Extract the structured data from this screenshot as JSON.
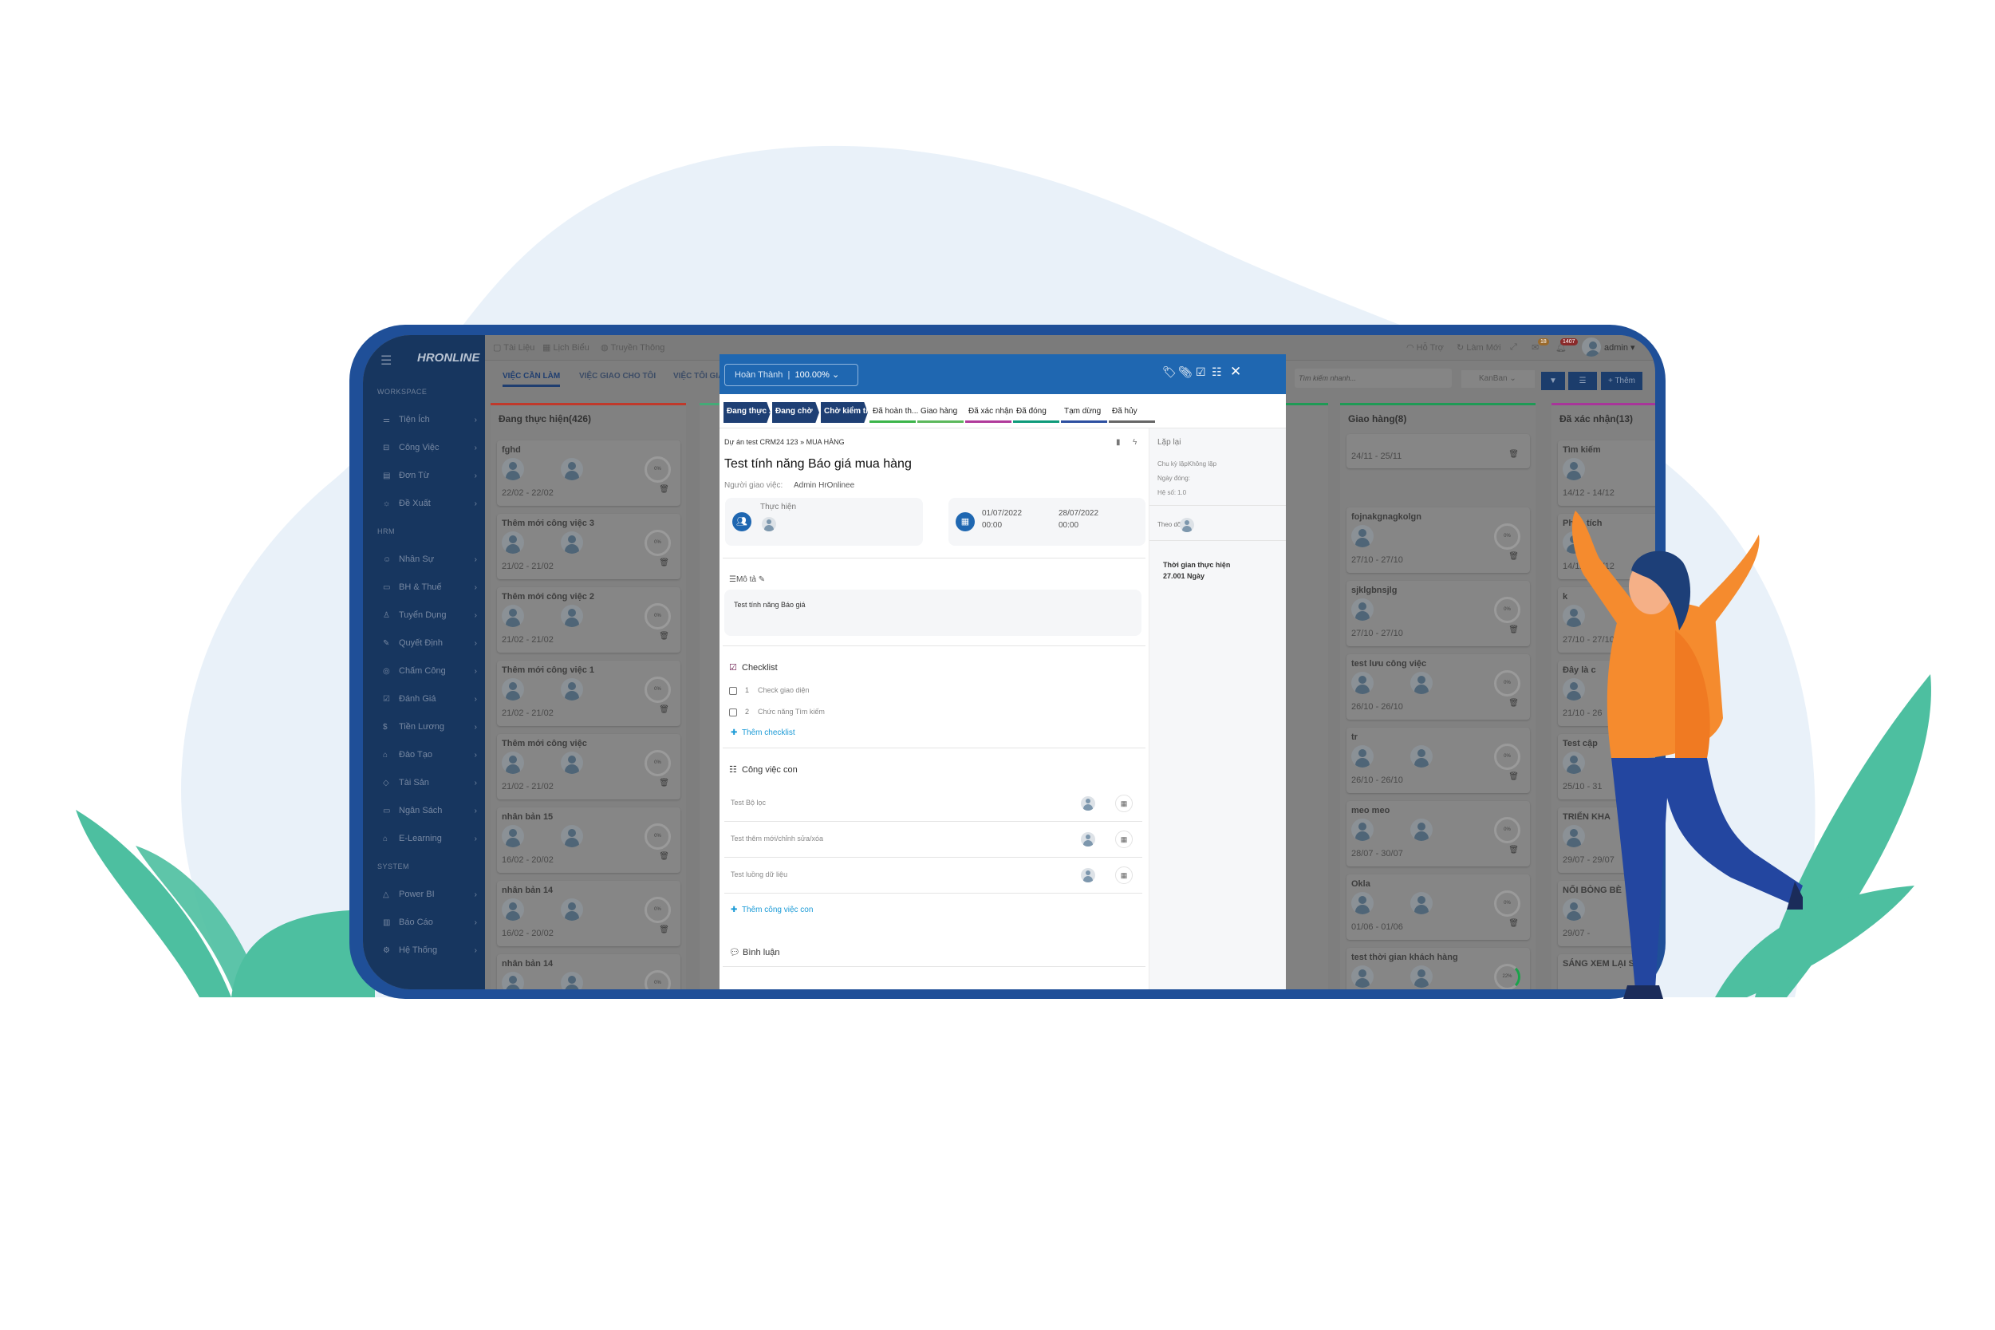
{
  "colors": {
    "brand": "#1f4f98",
    "modal_header": "#1f67b1",
    "leaf": "#4dbfa0",
    "blob": "#e9f1f9"
  },
  "app": {
    "logo": "HRONLINE",
    "topbar": {
      "links": [
        "Tài Liệu",
        "Lịch Biểu",
        "Truyền Thông"
      ],
      "support": "Hỗ Trợ",
      "refresh": "Làm Mới",
      "mail_badge": "18",
      "notif_badge": "1407",
      "user": "admin"
    },
    "tabs": [
      "VIỆC CẦN LÀM",
      "VIỆC GIAO CHO TÔI",
      "VIỆC TÔI GIA"
    ],
    "search_placeholder": "Tìm kiếm nhanh...",
    "view_select": "KanBan",
    "add_button": "+ Thêm",
    "sidebar": [
      {
        "section": "WORKSPACE"
      },
      {
        "label": "Tiện Ích",
        "icon": "sliders-icon"
      },
      {
        "label": "Công Việc",
        "icon": "briefcase-icon"
      },
      {
        "label": "Đơn Từ",
        "icon": "document-icon"
      },
      {
        "label": "Đề Xuất",
        "icon": "lightbulb-icon"
      },
      {
        "section": "HRM"
      },
      {
        "label": "Nhân Sự",
        "icon": "users-icon"
      },
      {
        "label": "BH & Thuế",
        "icon": "wallet-icon"
      },
      {
        "label": "Tuyển Dụng",
        "icon": "user-plus-icon"
      },
      {
        "label": "Quyết Định",
        "icon": "decision-icon"
      },
      {
        "label": "Chấm Công",
        "icon": "location-icon"
      },
      {
        "label": "Đánh Giá",
        "icon": "calendar-check-icon"
      },
      {
        "label": "Tiền Lương",
        "icon": "dollar-icon"
      },
      {
        "label": "Đào Tạo",
        "icon": "graduation-icon"
      },
      {
        "label": "Tài Sản",
        "icon": "diamond-icon"
      },
      {
        "label": "Ngân Sách",
        "icon": "wallet-icon"
      },
      {
        "label": "E-Learning",
        "icon": "graduation-icon"
      },
      {
        "section": "SYSTEM"
      },
      {
        "label": "Power BI",
        "icon": "chart-area-icon"
      },
      {
        "label": "Báo Cáo",
        "icon": "bar-chart-icon"
      },
      {
        "label": "Hệ Thống",
        "icon": "gear-icon"
      }
    ],
    "columns": [
      {
        "title": "Đang thực hiện(426)",
        "color": "#c0392b",
        "cards": [
          {
            "title": "fghd",
            "date": "22/02 - 22/02",
            "avatars": 2,
            "progress": "0%"
          },
          {
            "title": "Thêm mới công việc 3",
            "date": "21/02 - 21/02",
            "avatars": 2,
            "progress": "0%"
          },
          {
            "title": "Thêm mới công việc 2",
            "date": "21/02 - 21/02",
            "avatars": 2,
            "progress": "0%"
          },
          {
            "title": "Thêm mới công việc 1",
            "date": "21/02 - 21/02",
            "avatars": 2,
            "progress": "0%"
          },
          {
            "title": "Thêm mới công việc",
            "date": "21/02 - 21/02",
            "avatars": 2,
            "progress": "0%"
          },
          {
            "title": "nhân bản 15",
            "date": "16/02 - 20/02",
            "avatars": 2,
            "progress": "0%"
          },
          {
            "title": "nhân bản 14",
            "date": "16/02 - 20/02",
            "avatars": 2,
            "progress": "0%"
          },
          {
            "title": "nhân bản 14",
            "date": "",
            "avatars": 2,
            "progress": "0%"
          }
        ]
      },
      {
        "title": "Giao hàng(8)",
        "color": "#1e9a55",
        "cards": [
          {
            "title": "",
            "date": "24/11 - 25/11",
            "avatars": 0,
            "progress": ""
          },
          {
            "title": "fojnakgnagkolgn",
            "date": "27/10 - 27/10",
            "avatars": 1,
            "progress": "0%"
          },
          {
            "title": "sjklgbnsjlg",
            "date": "27/10 - 27/10",
            "avatars": 1,
            "progress": "0%"
          },
          {
            "title": "test lưu công việc",
            "date": "26/10 - 26/10",
            "avatars": 2,
            "progress": "0%"
          },
          {
            "title": "tr",
            "date": "26/10 - 26/10",
            "avatars": 2,
            "progress": "0%"
          },
          {
            "title": "meo meo",
            "date": "28/07 - 30/07",
            "avatars": 2,
            "progress": "0%"
          },
          {
            "title": "Okla",
            "date": "01/06 - 01/06",
            "avatars": 2,
            "progress": "0%"
          },
          {
            "title": "test thời gian khách hàng",
            "date": "29/07 - 31/08",
            "avatars": 2,
            "progress": "22%"
          }
        ]
      },
      {
        "title": "Đã xác nhận(13)",
        "color": "#a8359a",
        "cards": [
          {
            "title": "Tìm kiếm",
            "date": "14/12 - 14/12",
            "avatars": 1,
            "progress": ""
          },
          {
            "title": "Phân tích",
            "date": "14/12 - 14/12",
            "avatars": 1,
            "progress": ""
          },
          {
            "title": "k",
            "date": "27/10 - 27/10",
            "avatars": 1,
            "progress": ""
          },
          {
            "title": "Đây là c",
            "date": "21/10 - 26",
            "avatars": 1,
            "progress": ""
          },
          {
            "title": "Test cập",
            "date": "25/10 - 31",
            "avatars": 1,
            "progress": ""
          },
          {
            "title": "TRIỂN KHA",
            "date": "29/07 - 29/07",
            "avatars": 1,
            "progress": ""
          },
          {
            "title": "NỐI BÒNG BÈ",
            "date": "29/07 -",
            "avatars": 1,
            "progress": ""
          },
          {
            "title": "SÁNG XEM LẠI S BLỘ DỄ KHÔNG",
            "date": "",
            "avatars": 0,
            "progress": ""
          }
        ]
      }
    ]
  },
  "modal": {
    "status_label": "Hoàn Thành",
    "status_value": "100.00%",
    "header_icons": [
      "tag-icon",
      "paperclip-icon",
      "checkbox-icon",
      "list-icon",
      "close-icon"
    ],
    "stages": [
      {
        "label": "Đang thực ...",
        "style": "chip"
      },
      {
        "label": "Đang chờ",
        "style": "chip"
      },
      {
        "label": "Chờ kiểm tra",
        "style": "chip"
      },
      {
        "label": "Đã hoàn th...",
        "color": "#3cb54a"
      },
      {
        "label": "Giao hàng",
        "color": "#5cb85c"
      },
      {
        "label": "Đã xác nhận",
        "color": "#b03a9a"
      },
      {
        "label": "Đã đóng",
        "color": "#0e9a7a"
      },
      {
        "label": "Tạm dừng",
        "color": "#2d4fa0"
      },
      {
        "label": "Đã hủy",
        "color": "#666666"
      }
    ],
    "breadcrumb": "Dự án test CRM24 123 » MUA HÀNG",
    "title": "Test tính năng Báo giá mua hàng",
    "assigner_label": "Người giao việc:",
    "assigner": "Admin HrOnlinee",
    "performer_label": "Thực hiện",
    "start_date": "01/07/2022",
    "start_time": "00:00",
    "end_date": "28/07/2022",
    "end_time": "00:00",
    "description_label": "Mô tả",
    "description": "Test tính năng Báo giá",
    "checklist_label": "Checklist",
    "checklist": [
      {
        "no": "1",
        "text": "Check giao diện",
        "done": false
      },
      {
        "no": "2",
        "text": "Chức năng Tìm kiếm",
        "done": false
      }
    ],
    "add_checklist": "Thêm checklist",
    "subtasks_label": "Công việc con",
    "subtasks": [
      "Test Bộ lọc",
      "Test thêm mới/chỉnh sửa/xóa",
      "Test luồng dữ liệu"
    ],
    "add_subtask": "Thêm công việc con",
    "comments_label": "Bình luận",
    "repeat_label": "Lặp lại",
    "cycle_label": "Chu kỳ lặp:",
    "cycle_value": "Không lặp",
    "close_date_label": "Ngày đóng:",
    "coef_label": "Hệ số:",
    "coef_value": "1.0",
    "follow_label": "Theo dõi",
    "duration_label": "Thời gian thực hiện",
    "duration_value": "27.001 Ngày"
  }
}
